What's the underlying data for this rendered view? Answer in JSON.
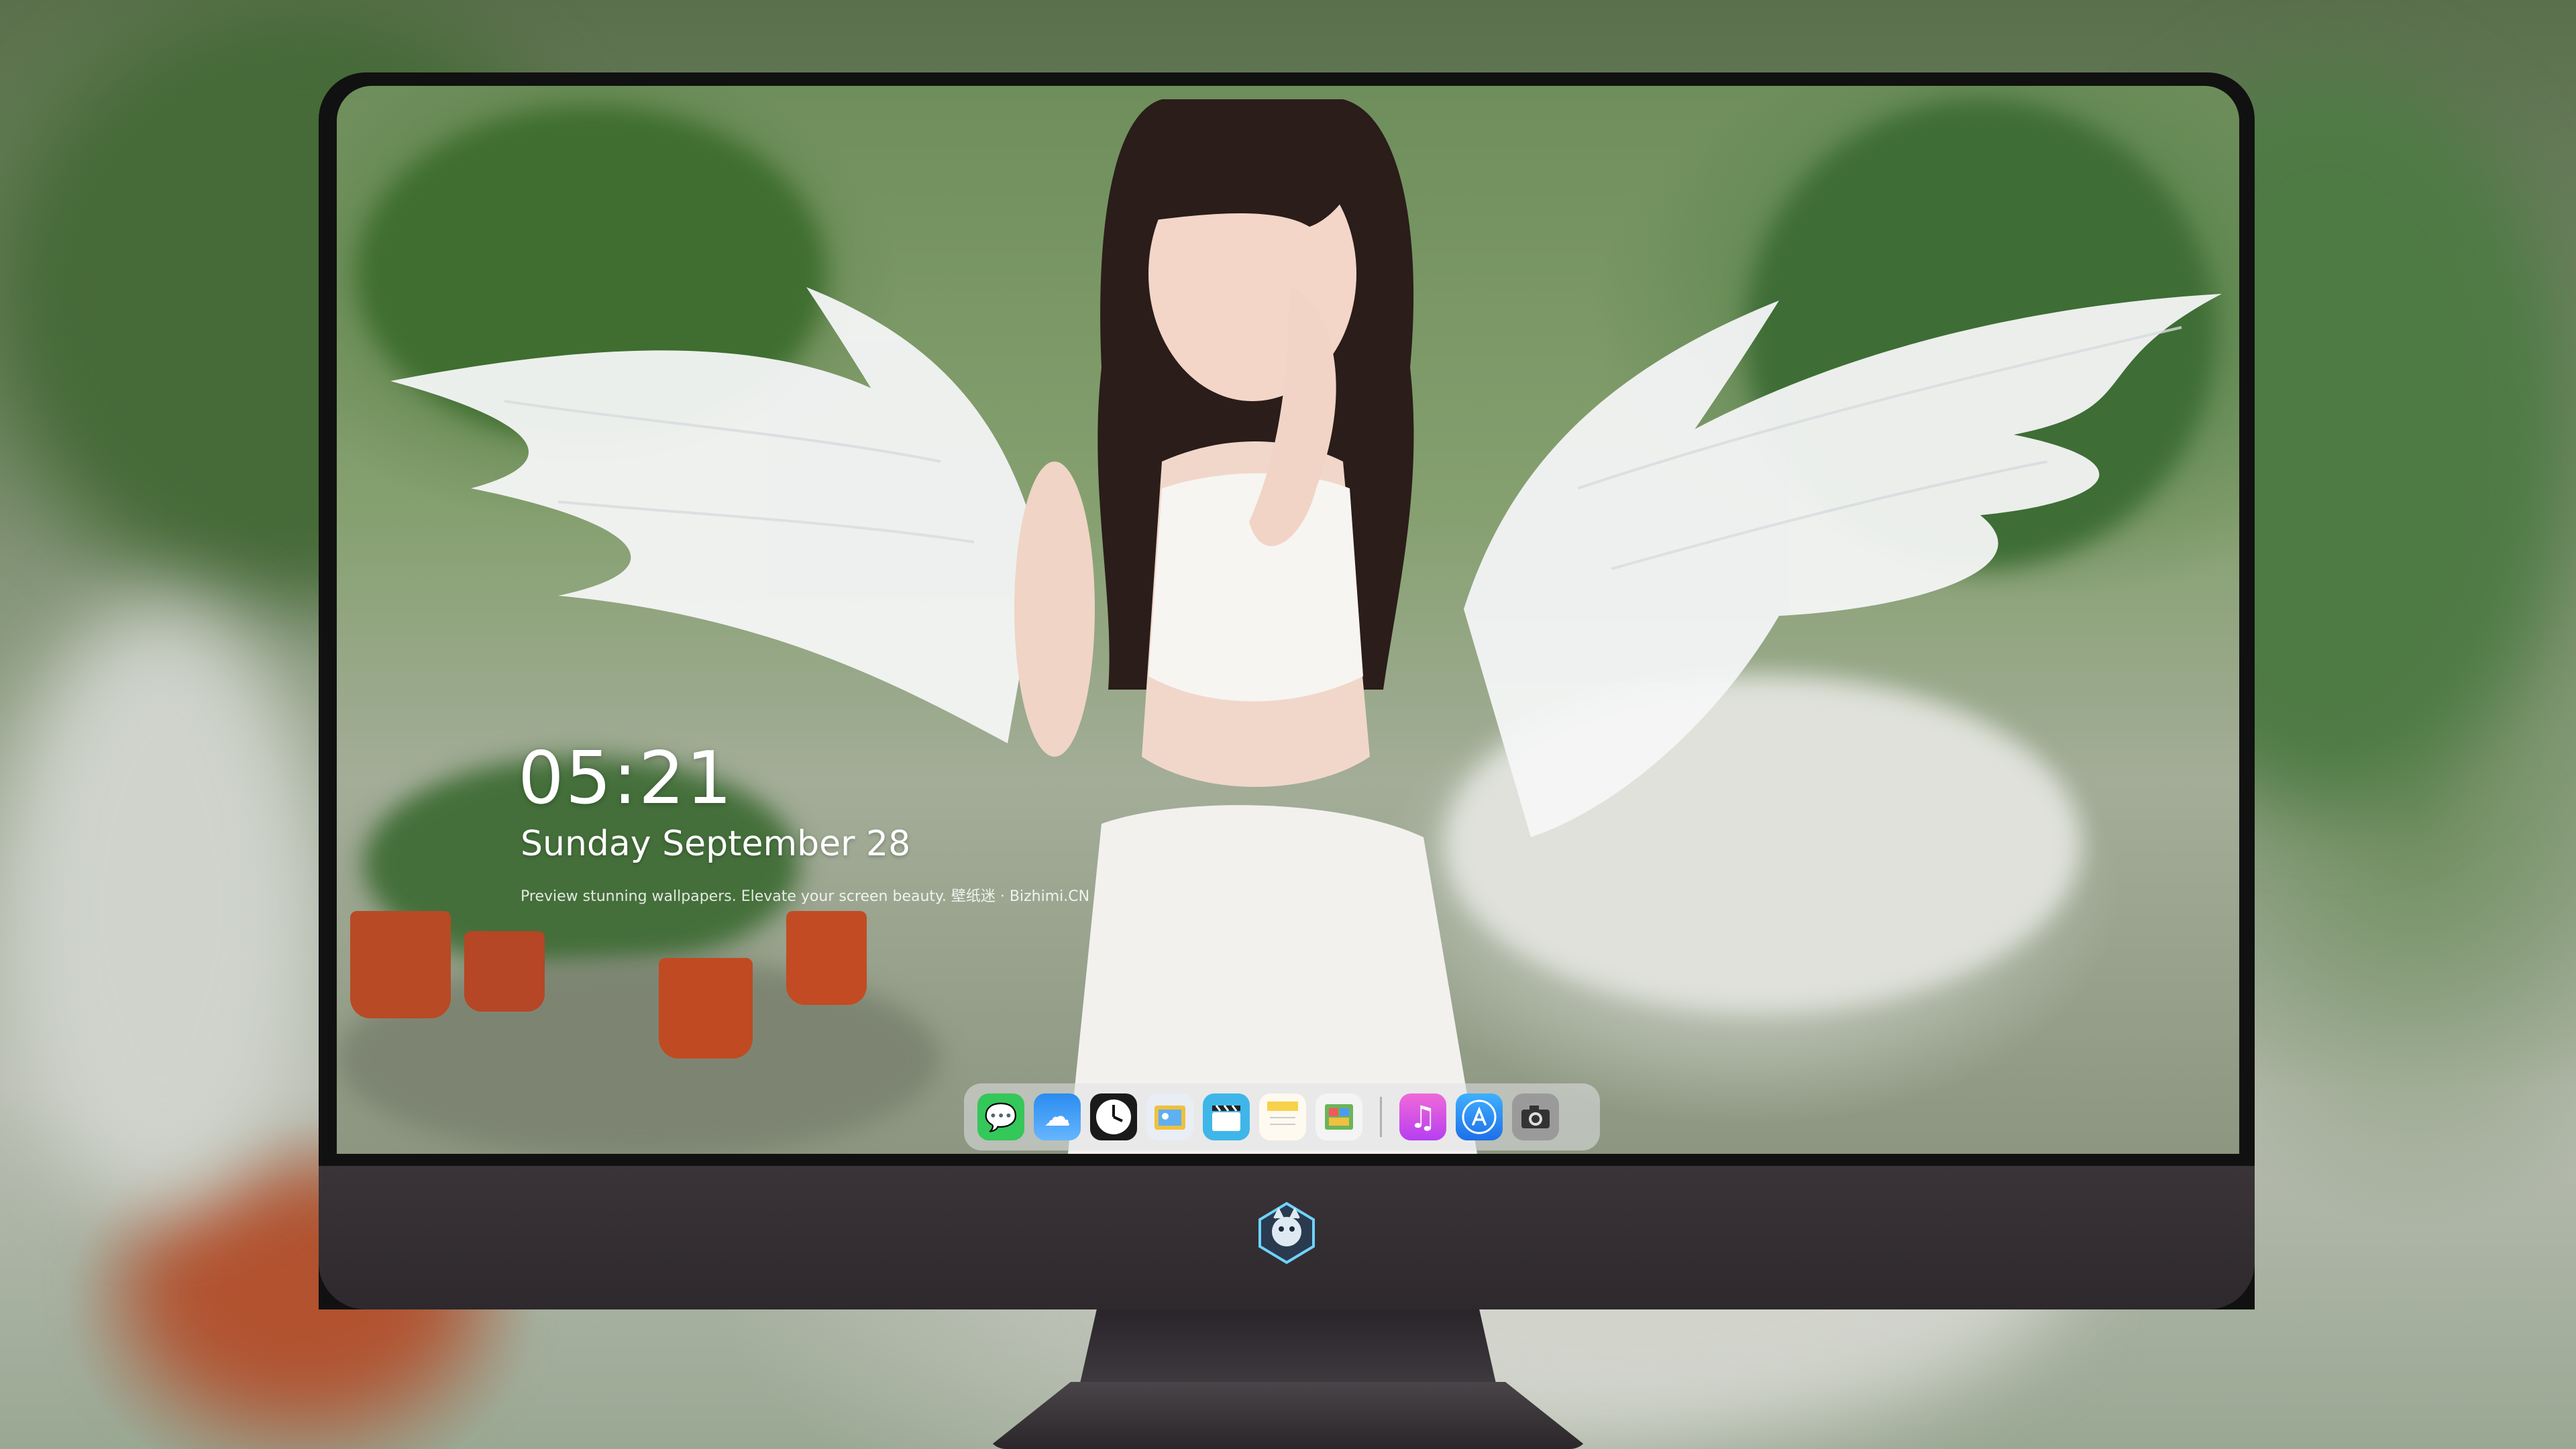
{
  "lockscreen": {
    "time": "05:21",
    "date": "Sunday September  28",
    "tagline": "Preview stunning wallpapers. Elevate your screen beauty. 壁纸迷 · Bizhimi.CN"
  },
  "dock": {
    "apps": [
      {
        "icon": "messages-icon",
        "glyph": "💬",
        "color": "#34c759"
      },
      {
        "icon": "weather-icon",
        "glyph": "☁",
        "color": "#2a8cf0"
      },
      {
        "icon": "clock-icon",
        "glyph": "🕒",
        "color": "#ffffff"
      },
      {
        "icon": "preview-icon",
        "glyph": "🖼",
        "color": "#f0c040"
      },
      {
        "icon": "video-editor-icon",
        "glyph": "🎬",
        "color": "#3fb6e8"
      },
      {
        "icon": "notes-icon",
        "glyph": "📝",
        "color": "#f7d24a"
      },
      {
        "icon": "photos-icon",
        "glyph": "📷",
        "color": "#6cb45a"
      },
      {
        "icon": "music-icon",
        "glyph": "♫",
        "color": "#e84bd2"
      },
      {
        "icon": "app-store-icon",
        "glyph": "A",
        "color": "#1e90ff"
      },
      {
        "icon": "camera-icon",
        "glyph": "📷",
        "color": "#8a8a8a"
      }
    ]
  },
  "colors": {
    "monitor_bezel": "#111111",
    "monitor_chin": "#332e32",
    "dock_bg": "rgba(225,225,230,0.55)"
  }
}
